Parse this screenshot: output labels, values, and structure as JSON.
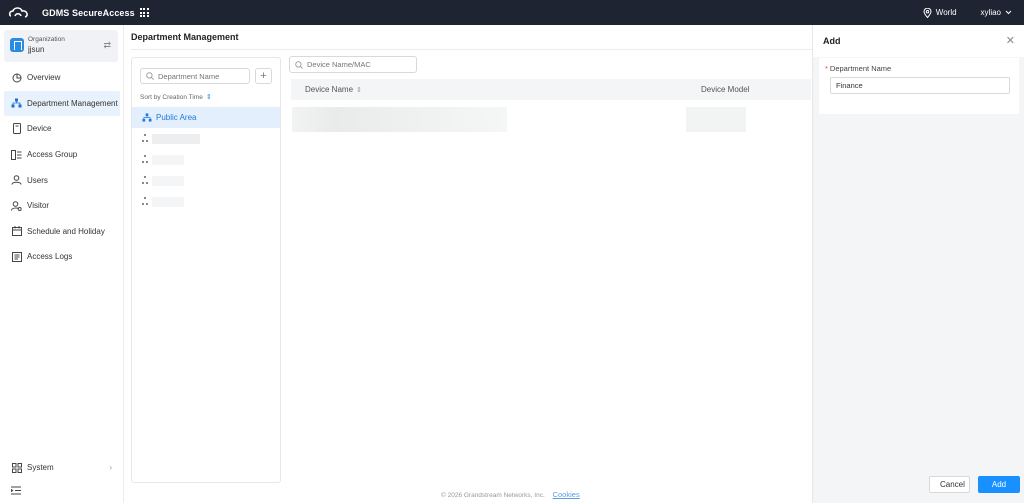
{
  "topbar": {
    "app_title": "GDMS SecureAccess",
    "region": "World",
    "username": "xyliao"
  },
  "sidebar": {
    "org_label": "Organization",
    "org_name": "jjsun",
    "items": [
      {
        "label": "Overview",
        "icon": "chart-pie-icon"
      },
      {
        "label": "Department Management",
        "icon": "org-tree-icon"
      },
      {
        "label": "Device",
        "icon": "device-icon"
      },
      {
        "label": "Access Group",
        "icon": "access-group-icon"
      },
      {
        "label": "Users",
        "icon": "users-icon"
      },
      {
        "label": "Visitor",
        "icon": "visitor-icon"
      },
      {
        "label": "Schedule and Holiday",
        "icon": "calendar-icon"
      },
      {
        "label": "Access Logs",
        "icon": "logs-icon"
      }
    ],
    "active_index": 1,
    "system_label": "System"
  },
  "main": {
    "title": "Department Management",
    "dept_search_placeholder": "Department Name",
    "sort_label": "Sort by Creation Time",
    "tree": [
      {
        "label": "Public Area",
        "selected": true
      }
    ],
    "device_search_placeholder": "Device Name/MAC",
    "columns": [
      "Device Name",
      "Device Model"
    ],
    "footer_text": "© 2026 Grandstream Networks, Inc.",
    "footer_link": "Cookies"
  },
  "drawer": {
    "title": "Add",
    "field_label": "Department Name",
    "field_value": "Finance",
    "cancel_label": "Cancel",
    "add_label": "Add"
  },
  "colors": {
    "topbar": "#1f2433",
    "accent": "#1890ff",
    "active_bg": "#e7f2fd"
  }
}
